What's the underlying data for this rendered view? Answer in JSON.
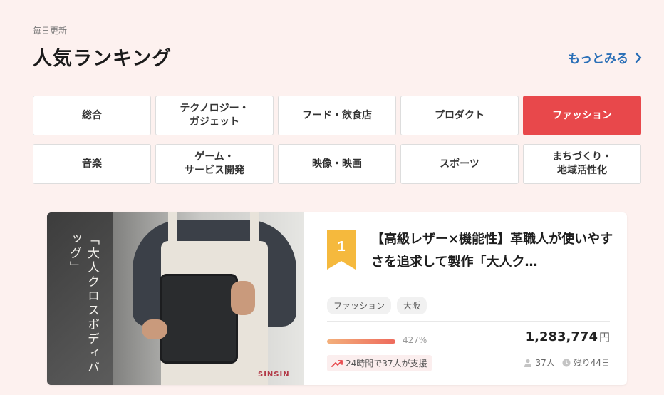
{
  "header": {
    "eyebrow": "毎日更新",
    "title": "人気ランキング",
    "more_label": "もっとみる"
  },
  "categories": [
    {
      "label": "総合",
      "active": false
    },
    {
      "label": "テクノロジー・\nガジェット",
      "active": false
    },
    {
      "label": "フード・飲食店",
      "active": false
    },
    {
      "label": "プロダクト",
      "active": false
    },
    {
      "label": "ファッション",
      "active": true
    },
    {
      "label": "音楽",
      "active": false
    },
    {
      "label": "ゲーム・\nサービス開発",
      "active": false
    },
    {
      "label": "映像・映画",
      "active": false
    },
    {
      "label": "スポーツ",
      "active": false
    },
    {
      "label": "まちづくり・\n地域活性化",
      "active": false
    }
  ],
  "project": {
    "image_caption": "「大人クロスボディバッグ」",
    "image_logo": "SINSIN",
    "rank": "1",
    "title": "【高級レザー×機能性】革職人が使いやすさを追求して製作「大人ク…",
    "tags": [
      "ファッション",
      "大阪"
    ],
    "progress_percent": 427,
    "progress_label": "427%",
    "amount": "1,283,774",
    "currency": "円",
    "support_note": "24時間で37人が支援",
    "supporters": "37人",
    "remaining": "残り44日"
  },
  "colors": {
    "background": "#fdf1ef",
    "accent": "#e8484b",
    "link": "#2a6fb7",
    "rank_badge": "#f5b93d"
  },
  "icons": {
    "more": "chevron-right-icon",
    "trend": "trend-up-icon",
    "supporters": "person-icon",
    "remaining": "clock-icon"
  }
}
